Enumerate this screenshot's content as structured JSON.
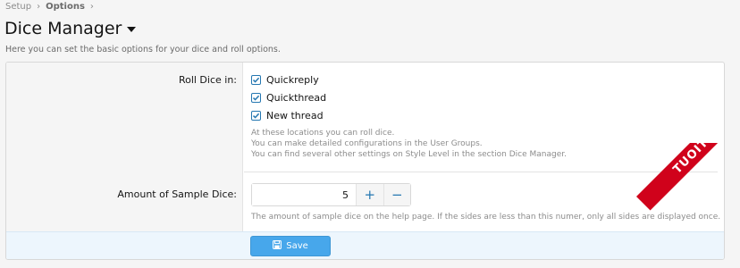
{
  "breadcrumb": {
    "items": [
      "Setup",
      "Options"
    ],
    "separator": "›"
  },
  "page": {
    "title": "Dice Manager",
    "description": "Here you can set the basic options for your dice and roll options."
  },
  "roll_dice": {
    "label": "Roll Dice in:",
    "options": [
      {
        "label": "Quickreply",
        "checked": true
      },
      {
        "label": "Quickthread",
        "checked": true
      },
      {
        "label": "New thread",
        "checked": true
      }
    ],
    "hints": [
      "At these locations you can roll dice.",
      "You can make detailed configurations in the User Groups.",
      "You can find several other settings on Style Level in the section Dice Manager."
    ]
  },
  "sample_dice": {
    "label": "Amount of Sample Dice:",
    "value": "5",
    "plus": "+",
    "minus": "−",
    "hint": "The amount of sample dice on the help page. If the sides are less than this numer, only all sides are displayed once."
  },
  "footer": {
    "save_label": "Save"
  },
  "watermark": {
    "text": "TUOITRE.VN"
  },
  "colors": {
    "accent": "#2577b1",
    "button": "#47a7eb",
    "watermark": "#d0021b"
  }
}
